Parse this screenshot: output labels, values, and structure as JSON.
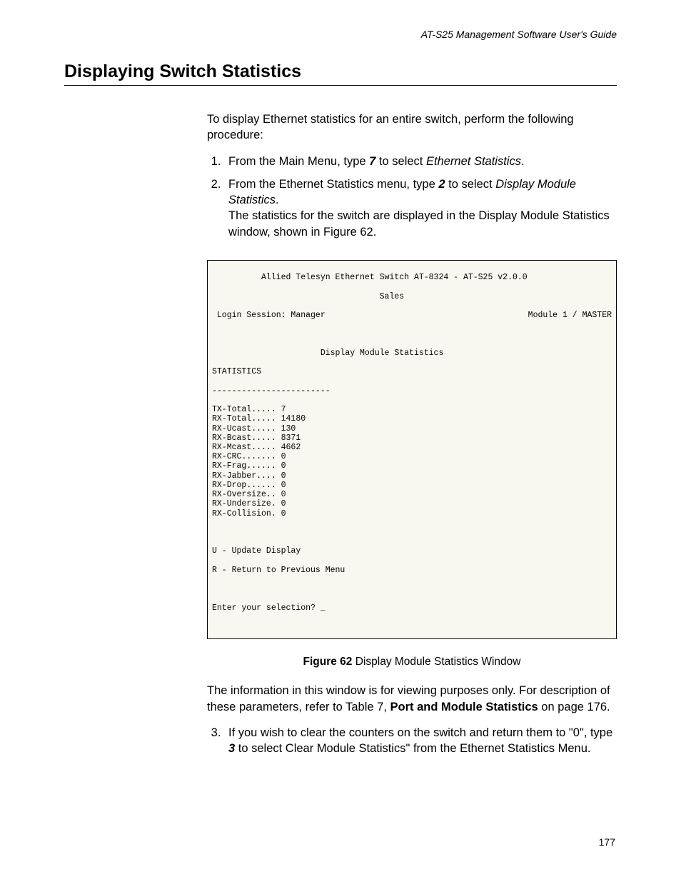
{
  "header": {
    "running": "AT-S25 Management Software User's Guide"
  },
  "section": {
    "heading": "Displaying Switch Statistics"
  },
  "intro_prefix": "To display Ethernet statistics for an entire switch, perform the following procedure:",
  "steps": {
    "s1": {
      "a": "From the Main Menu, type ",
      "key": "7",
      "b": " to select ",
      "menu": "Ethernet Statistics",
      "c": "."
    },
    "s2": {
      "a": "From the Ethernet Statistics menu, type ",
      "key": "2",
      "b": " to select ",
      "menu": "Display Module Statistics",
      "c": ".",
      "sub": "The statistics for the switch are displayed in the Display Module Statistics window, shown in Figure 62."
    },
    "s3": {
      "a": "If you wish to clear the counters on the switch and return them to \"0\", type ",
      "key": "3",
      "b": " to select Clear Module Statistics\" from the Ethernet Statistics Menu."
    }
  },
  "terminal": {
    "title": "          Allied Telesyn Ethernet Switch AT-8324 - AT-S25 v2.0.0",
    "subtitle": "                                  Sales",
    "session_left": " Login Session: Manager",
    "session_right": "Module 1 / MASTER",
    "heading": "                      Display Module Statistics",
    "stats_header": "STATISTICS",
    "divider": "------------------------",
    "rows": [
      {
        "label": "TX-Total",
        "dots": ".....",
        "val": "7"
      },
      {
        "label": "RX-Total",
        "dots": ".....",
        "val": "14180"
      },
      {
        "label": "RX-Ucast",
        "dots": ".....",
        "val": "130"
      },
      {
        "label": "RX-Bcast",
        "dots": ".....",
        "val": "8371"
      },
      {
        "label": "RX-Mcast",
        "dots": ".....",
        "val": "4662"
      },
      {
        "label": "RX-CRC",
        "dots": ".......",
        "val": "0"
      },
      {
        "label": "RX-Frag",
        "dots": "......",
        "val": "0"
      },
      {
        "label": "RX-Jabber",
        "dots": "....",
        "val": "0"
      },
      {
        "label": "RX-Drop",
        "dots": "......",
        "val": "0"
      },
      {
        "label": "RX-Oversize",
        "dots": "..",
        "val": "0"
      },
      {
        "label": "RX-Undersize",
        "dots": ".",
        "val": "0"
      },
      {
        "label": "RX-Collision",
        "dots": ".",
        "val": "0"
      }
    ],
    "menu_u": "U - Update Display",
    "menu_r": "R - Return to Previous Menu",
    "prompt": "Enter your selection? _"
  },
  "figure": {
    "label": "Figure 62",
    "caption": "  Display Module Statistics Window"
  },
  "after_figure": {
    "a": "The information in this window is for viewing purposes only. For description of these parameters, refer to Table 7, ",
    "ref": "Port and Module Statistics",
    "b": " on page 176."
  },
  "page_number": "177"
}
